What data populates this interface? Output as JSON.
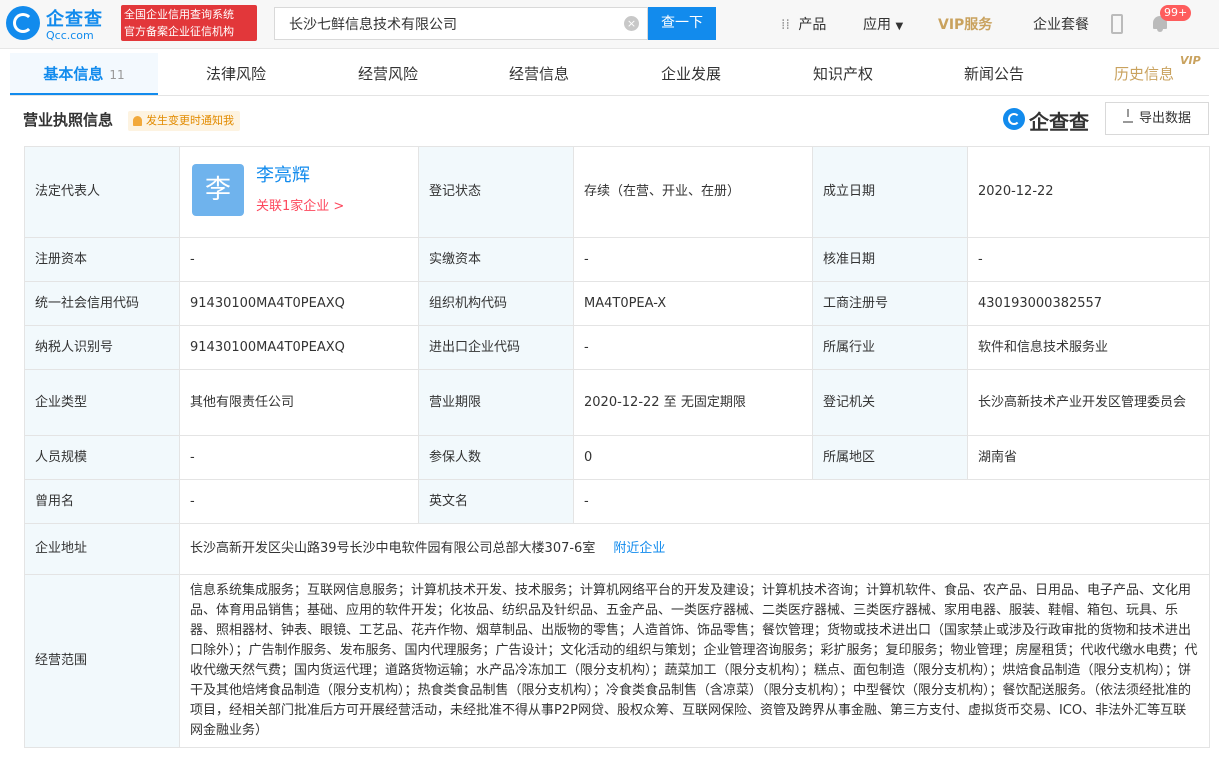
{
  "header": {
    "logo_cn": "企查查",
    "logo_en": "Qcc.com",
    "badge_line1": "全国企业信用查询系统",
    "badge_line2": "官方备案企业征信机构",
    "search_value": "长沙七鲜信息技术有限公司",
    "search_button": "查一下",
    "nav_products": "产品",
    "nav_apps": "应用",
    "nav_vip": "VIP服务",
    "nav_package": "企业套餐",
    "notification_count": "99+"
  },
  "tabs": [
    {
      "label": "基本信息",
      "count": "11"
    },
    {
      "label": "法律风险"
    },
    {
      "label": "经营风险"
    },
    {
      "label": "经营信息"
    },
    {
      "label": "企业发展"
    },
    {
      "label": "知识产权"
    },
    {
      "label": "新闻公告"
    },
    {
      "label": "历史信息",
      "badge": "VIP"
    }
  ],
  "section": {
    "title": "营业执照信息",
    "notice": "发生变更时通知我",
    "brand": "企查查",
    "export": "导出数据"
  },
  "license": {
    "legal_rep_label": "法定代表人",
    "legal_rep_avatar": "李",
    "legal_rep_name": "李亮辉",
    "legal_rep_link": "关联1家企业 >",
    "reg_status_label": "登记状态",
    "reg_status": "存续（在营、开业、在册）",
    "founded_label": "成立日期",
    "founded": "2020-12-22",
    "capital_label": "注册资本",
    "capital": "-",
    "paid_label": "实缴资本",
    "paid": "-",
    "approved_label": "核准日期",
    "approved": "-",
    "credit_code_label": "统一社会信用代码",
    "credit_code": "91430100MA4T0PEAXQ",
    "org_code_label": "组织机构代码",
    "org_code": "MA4T0PEA-X",
    "reg_no_label": "工商注册号",
    "reg_no": "430193000382557",
    "tax_id_label": "纳税人识别号",
    "tax_id": "91430100MA4T0PEAXQ",
    "import_export_label": "进出口企业代码",
    "import_export": "-",
    "industry_label": "所属行业",
    "industry": "软件和信息技术服务业",
    "type_label": "企业类型",
    "type": "其他有限责任公司",
    "term_label": "营业期限",
    "term": "2020-12-22 至 无固定期限",
    "authority_label": "登记机关",
    "authority": "长沙高新技术产业开发区管理委员会",
    "staff_label": "人员规模",
    "staff": "-",
    "insured_label": "参保人数",
    "insured": "0",
    "region_label": "所属地区",
    "region": "湖南省",
    "former_name_label": "曾用名",
    "former_name": "-",
    "english_label": "英文名",
    "english": "-",
    "address_label": "企业地址",
    "address": "长沙高新开发区尖山路39号长沙中电软件园有限公司总部大楼307-6室",
    "nearby": "附近企业",
    "scope_label": "经营范围",
    "scope": "信息系统集成服务；互联网信息服务；计算机技术开发、技术服务；计算机网络平台的开发及建设；计算机技术咨询；计算机软件、食品、农产品、日用品、电子产品、文化用品、体育用品销售；基础、应用的软件开发；化妆品、纺织品及针织品、五金产品、一类医疗器械、二类医疗器械、三类医疗器械、家用电器、服装、鞋帽、箱包、玩具、乐器、照相器材、钟表、眼镜、工艺品、花卉作物、烟草制品、出版物的零售；人造首饰、饰品零售；餐饮管理；货物或技术进出口（国家禁止或涉及行政审批的货物和技术进出口除外）；广告制作服务、发布服务、国内代理服务；广告设计；文化活动的组织与策划；企业管理咨询服务；彩扩服务；复印服务；物业管理；房屋租赁；代收代缴水电费；代收代缴天然气费；国内货运代理；道路货物运输；水产品冷冻加工（限分支机构）；蔬菜加工（限分支机构）；糕点、面包制造（限分支机构）；烘焙食品制造（限分支机构）；饼干及其他焙烤食品制造（限分支机构）；热食类食品制售（限分支机构）；冷食类食品制售（含凉菜）（限分支机构）；中型餐饮（限分支机构）；餐饮配送服务。（依法须经批准的项目，经相关部门批准后方可开展经营活动，未经批准不得从事P2P网贷、股权众筹、互联网保险、资管及跨界从事金融、第三方支付、虚拟货币交易、ICO、非法外汇等互联网金融业务）"
  }
}
